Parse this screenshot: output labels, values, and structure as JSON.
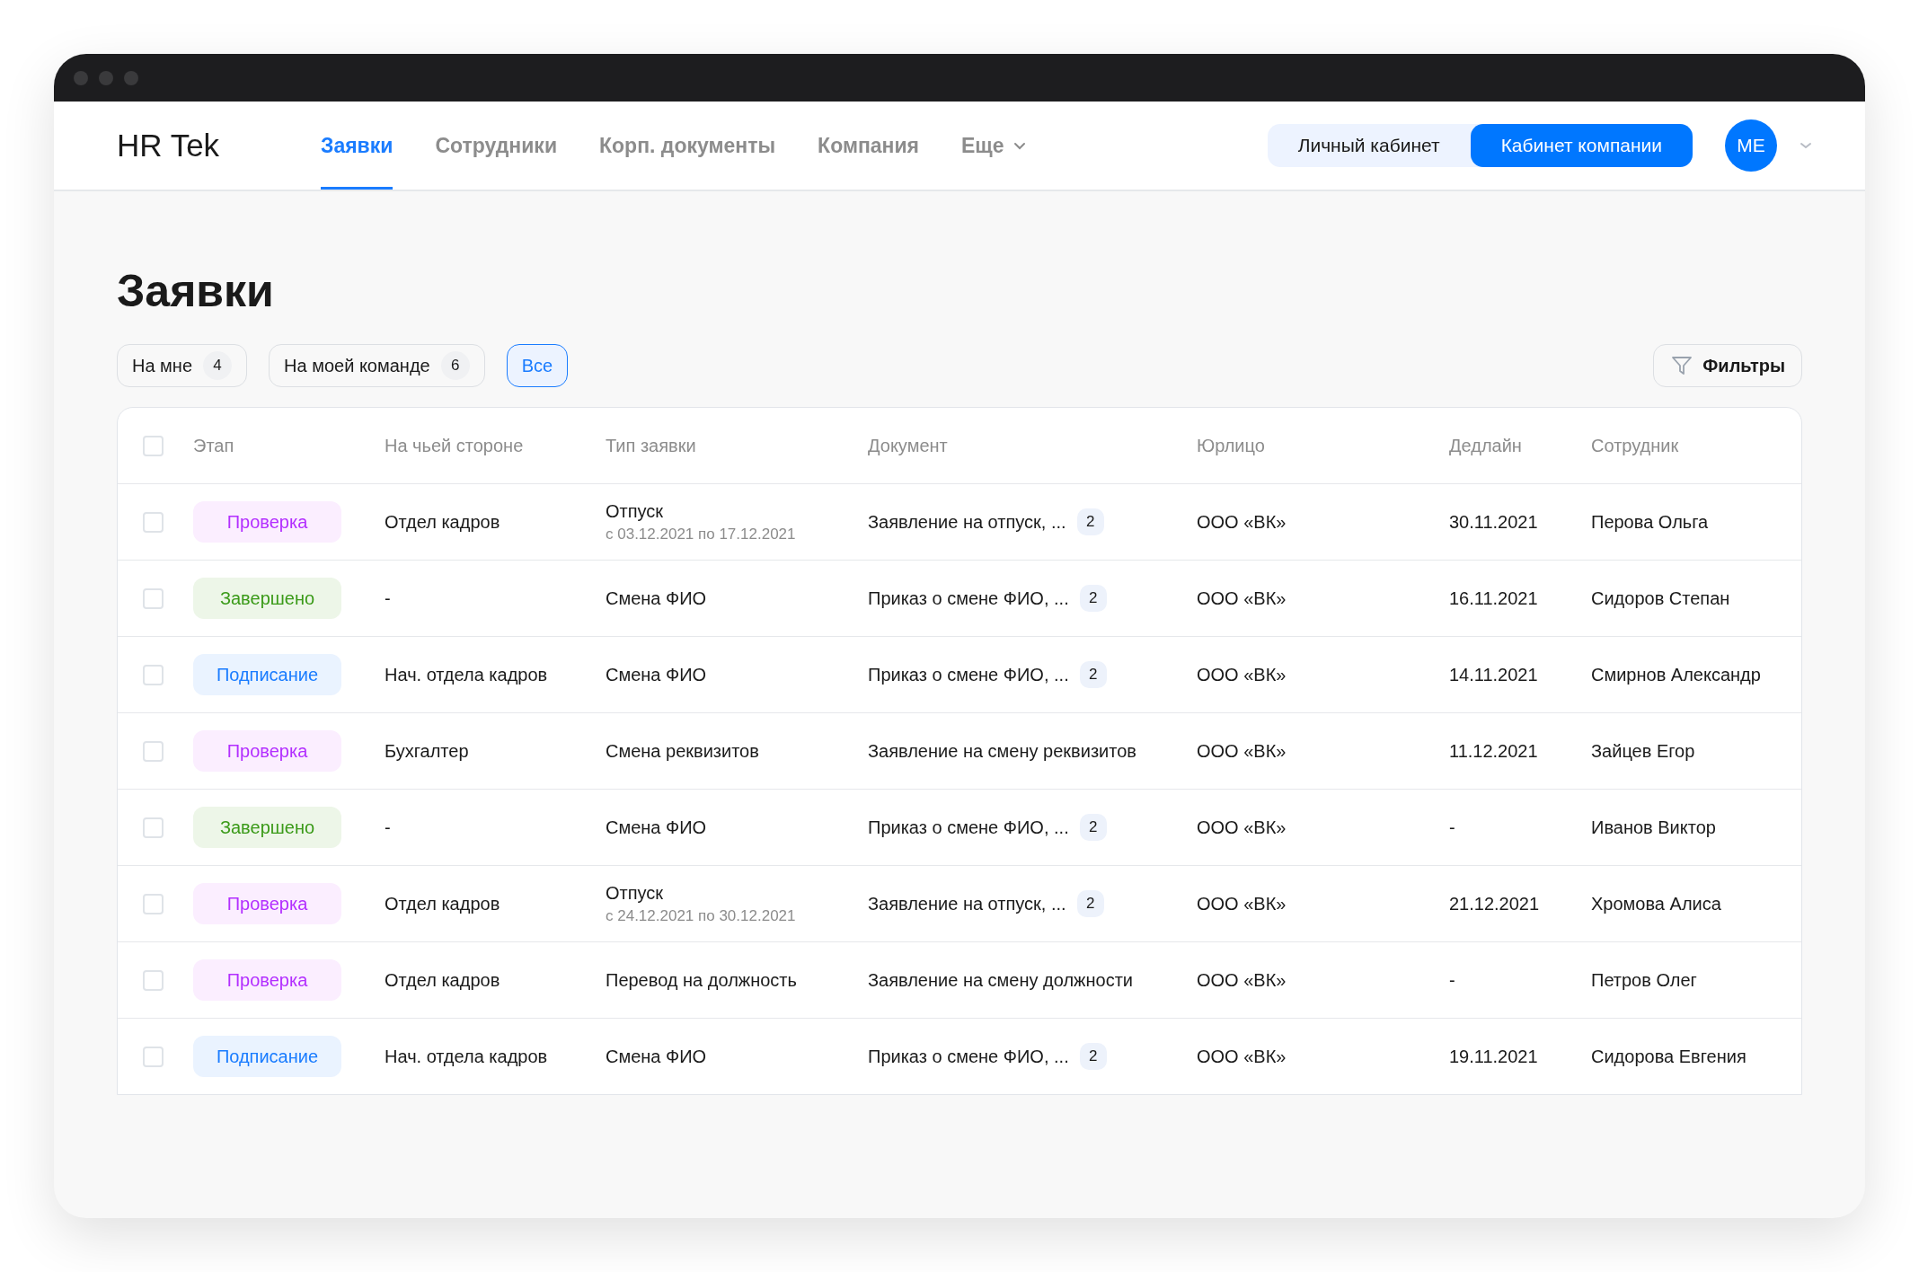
{
  "logo": "HR Tek",
  "nav": [
    {
      "label": "Заявки",
      "selected": true
    },
    {
      "label": "Сотрудники",
      "selected": false
    },
    {
      "label": "Корп. документы",
      "selected": false
    },
    {
      "label": "Компания",
      "selected": false
    },
    {
      "label": "Еще",
      "selected": false,
      "dropdown": true
    }
  ],
  "cabinet_switch": [
    {
      "label": "Личный кабинет",
      "selected": false
    },
    {
      "label": "Кабинет компании",
      "selected": true
    }
  ],
  "avatar": "ME",
  "page_title": "Заявки",
  "filter_chips": [
    {
      "label": "На мне",
      "count": "4",
      "selected": false
    },
    {
      "label": "На моей команде",
      "count": "6",
      "selected": false
    },
    {
      "label": "Все",
      "selected": true
    }
  ],
  "filters_button": "Фильтры",
  "table": {
    "columns": [
      "Этап",
      "На чьей стороне",
      "Тип заявки",
      "Документ",
      "Юрлицо",
      "Дедлайн",
      "Сотрудник"
    ],
    "header_checked": false,
    "rows": [
      {
        "checked": false,
        "stage": {
          "label": "Проверка",
          "kind": "review"
        },
        "side": "Отдел кадров",
        "type": "Отпуск",
        "type_note": "с 03.12.2021 по 17.12.2021",
        "document": "Заявление на отпуск, ...",
        "doc_count": "2",
        "entity": "ООО «ВК»",
        "deadline": "30.11.2021",
        "employee": "Перова Ольга"
      },
      {
        "checked": false,
        "stage": {
          "label": "Завершено",
          "kind": "done"
        },
        "side": "-",
        "type": "Смена ФИО",
        "document": "Приказ о смене ФИО, ...",
        "doc_count": "2",
        "entity": "ООО «ВК»",
        "deadline": "16.11.2021",
        "employee": "Сидоров Степан"
      },
      {
        "checked": false,
        "stage": {
          "label": "Подписание",
          "kind": "signing"
        },
        "side": "Нач. отдела кадров",
        "type": "Смена ФИО",
        "document": "Приказ о смене ФИО, ...",
        "doc_count": "2",
        "entity": "ООО «ВК»",
        "deadline": "14.11.2021",
        "employee": "Смирнов Александр"
      },
      {
        "checked": false,
        "stage": {
          "label": "Проверка",
          "kind": "review"
        },
        "side": "Бухгалтер",
        "type": "Смена реквизитов",
        "document": "Заявление на смену реквизитов",
        "entity": "ООО «ВК»",
        "deadline": "11.12.2021",
        "employee": "Зайцев Егор"
      },
      {
        "checked": false,
        "stage": {
          "label": "Завершено",
          "kind": "done"
        },
        "side": "-",
        "type": "Смена ФИО",
        "document": "Приказ о смене ФИО, ...",
        "doc_count": "2",
        "entity": "ООО «ВК»",
        "deadline": "-",
        "employee": "Иванов Виктор"
      },
      {
        "checked": false,
        "stage": {
          "label": "Проверка",
          "kind": "review"
        },
        "side": "Отдел кадров",
        "type": "Отпуск",
        "type_note": "с 24.12.2021 по 30.12.2021",
        "document": "Заявление на отпуск, ...",
        "doc_count": "2",
        "entity": "ООО «ВК»",
        "deadline": "21.12.2021",
        "employee": "Хромова Алиса"
      },
      {
        "checked": false,
        "stage": {
          "label": "Проверка",
          "kind": "review"
        },
        "side": "Отдел кадров",
        "type": "Перевод на должность",
        "document": "Заявление на смену должности",
        "entity": "ООО «ВК»",
        "deadline": "-",
        "employee": "Петров Олег"
      },
      {
        "checked": false,
        "stage": {
          "label": "Подписание",
          "kind": "signing"
        },
        "side": "Нач. отдела кадров",
        "type": "Смена ФИО",
        "document": "Приказ о смене ФИО, ...",
        "doc_count": "2",
        "entity": "ООО «ВК»",
        "deadline": "19.11.2021",
        "employee": "Сидорова Евгения"
      }
    ]
  }
}
